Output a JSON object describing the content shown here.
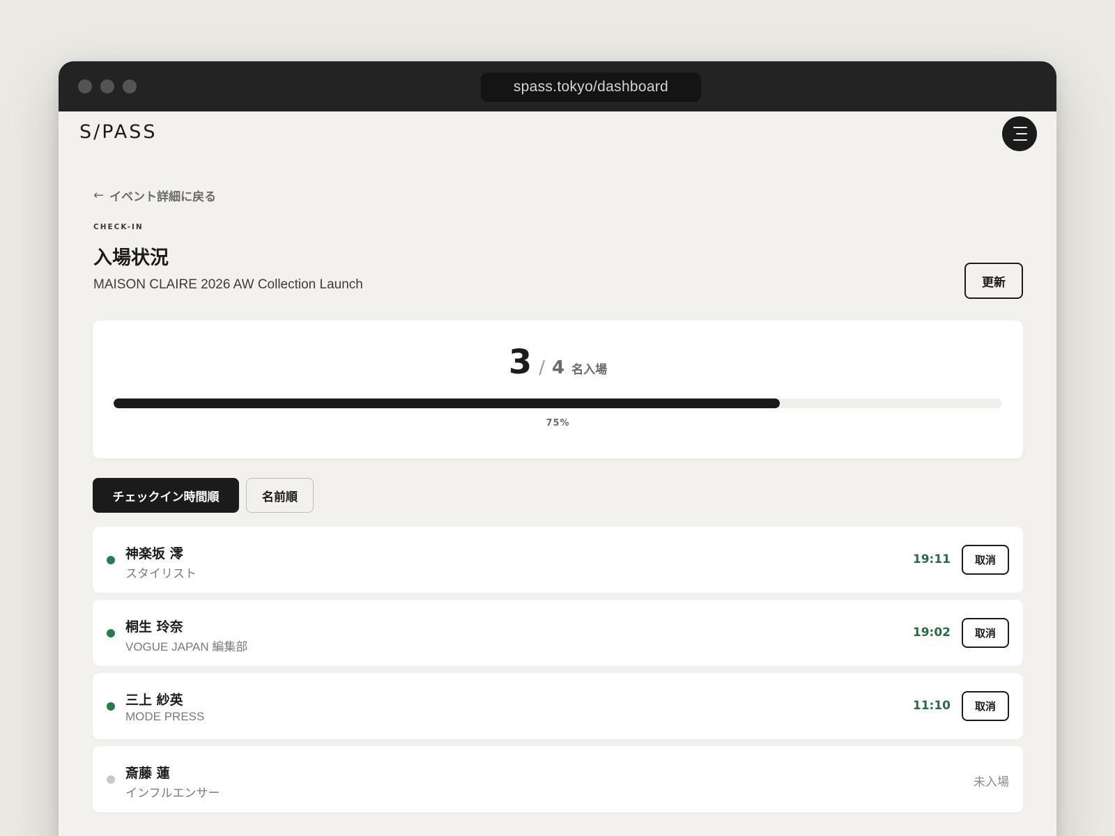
{
  "browser": {
    "url": "spass.tokyo/dashboard"
  },
  "header": {
    "logo": "S/PASS",
    "menu_icon": "hamburger-icon"
  },
  "page": {
    "back_link": "イベント詳細に戻る",
    "eyebrow": "CHECK-IN",
    "title": "入場状況",
    "event_name": "MAISON CLAIRE 2026 AW Collection Launch",
    "refresh_label": "更新"
  },
  "stats": {
    "checked_in": "3",
    "separator": "/",
    "total": "4",
    "unit": "名入場",
    "progress_percent": 75,
    "progress_label": "75%"
  },
  "sort_tabs": [
    {
      "label": "チェックイン時間順",
      "active": true
    },
    {
      "label": "名前順",
      "active": false
    }
  ],
  "colors": {
    "checked_in_dot": "#2a7a4a",
    "not_entered_dot": "#c9c8c4",
    "time_text": "#2a6b44"
  },
  "guests": [
    {
      "name": "神楽坂 澪",
      "org": "スタイリスト",
      "time": "19:11",
      "action": "取消",
      "checked_in": true
    },
    {
      "name": "桐生 玲奈",
      "org": "VOGUE JAPAN 編集部",
      "time": "19:02",
      "action": "取消",
      "checked_in": true
    },
    {
      "name": "三上 紗英",
      "org": "MODE PRESS",
      "time": "11:10",
      "action": "取消",
      "checked_in": true
    },
    {
      "name": "斎藤 蓮",
      "org": "インフルエンサー",
      "status": "未入場",
      "checked_in": false
    }
  ]
}
